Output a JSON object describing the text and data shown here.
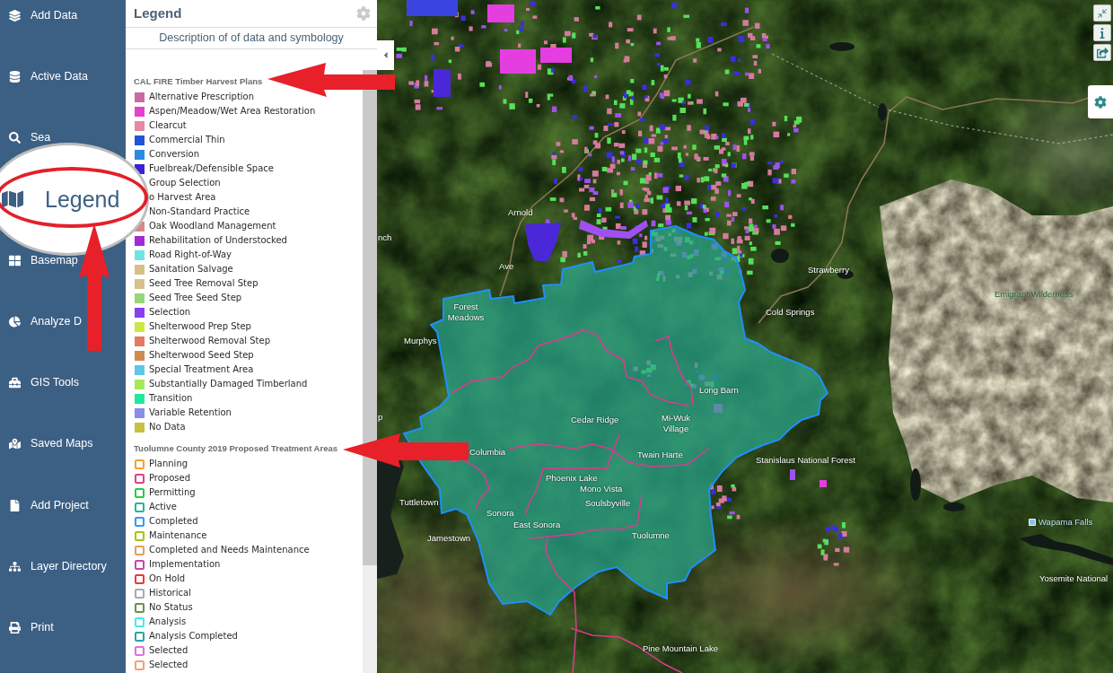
{
  "sidebar": {
    "items": [
      {
        "label": "Add Data",
        "magnified": false
      },
      {
        "label": "Active Data",
        "magnified": false
      },
      {
        "label": "Sea",
        "magnified": false
      },
      {
        "label": "Legend",
        "magnified": true
      },
      {
        "label": "Basemap",
        "magnified": false
      },
      {
        "label": "Analyze D",
        "magnified": false
      },
      {
        "label": "GIS Tools",
        "magnified": false
      },
      {
        "label": "Saved Maps",
        "magnified": false
      },
      {
        "label": "Add Project",
        "magnified": false
      },
      {
        "label": "Layer Directory",
        "magnified": false
      },
      {
        "label": "Print",
        "magnified": false
      }
    ]
  },
  "legend_panel": {
    "title": "Legend",
    "subtitle": "Description of of data and symbology",
    "sections": [
      {
        "title": "CAL FIRE Timber Harvest Plans",
        "kind": "fill",
        "items": [
          {
            "label": "Alternative Prescription",
            "color": "#c86aa0"
          },
          {
            "label": "Aspen/Meadow/Wet Area Restoration",
            "color": "#e83fd0"
          },
          {
            "label": "Clearcut",
            "color": "#e48aa2"
          },
          {
            "label": "Commercial Thin",
            "color": "#1f55d8"
          },
          {
            "label": "Conversion",
            "color": "#2b8be0"
          },
          {
            "label": "Fuelbreak/Defensible Space",
            "color": "#3a22d6"
          },
          {
            "label": "Group Selection"
          },
          {
            "label": "o Harvest Area"
          },
          {
            "label": "Non-Standard Practice"
          },
          {
            "label": "Oak Woodland Management",
            "color": "#d98888"
          },
          {
            "label": "Rehabilitation of Understocked",
            "color": "#a22ad8"
          },
          {
            "label": "Road Right-of-Way",
            "color": "#6de6de"
          },
          {
            "label": "Sanitation Salvage",
            "color": "#d8bf85"
          },
          {
            "label": "Seed Tree Removal Step",
            "color": "#d6c28a"
          },
          {
            "label": "Seed Tree Seed Step",
            "color": "#96d878"
          },
          {
            "label": "Selection",
            "color": "#8a3ef0"
          },
          {
            "label": "Shelterwood Prep Step",
            "color": "#cce840"
          },
          {
            "label": "Shelterwood Removal Step",
            "color": "#e47a60"
          },
          {
            "label": "Shelterwood Seed Step",
            "color": "#d08a50"
          },
          {
            "label": "Special Treatment Area",
            "color": "#5cc8e8"
          },
          {
            "label": "Substantially Damaged Timberland",
            "color": "#a8e858"
          },
          {
            "label": "Transition",
            "color": "#20e8a0"
          },
          {
            "label": "Variable Retention",
            "color": "#8a8cec"
          },
          {
            "label": "No Data",
            "color": "#c8c040"
          }
        ]
      },
      {
        "title": "Tuolumne County 2019 Proposed Treatment Areas",
        "kind": "outline",
        "items": [
          {
            "label": "Planning",
            "color": "#f5a030"
          },
          {
            "label": "Proposed",
            "color": "#e0408a"
          },
          {
            "label": "Permitting",
            "color": "#22cc44"
          },
          {
            "label": "Active",
            "color": "#1fb89a"
          },
          {
            "label": "Completed",
            "color": "#3399ff"
          },
          {
            "label": "Maintenance",
            "color": "#a8c400"
          },
          {
            "label": "Completed and Needs Maintenance",
            "color": "#e0a060"
          },
          {
            "label": "Implementation",
            "color": "#cc44aa"
          },
          {
            "label": "On Hold",
            "color": "#e83a3a"
          },
          {
            "label": "Historical",
            "color": "#aaaaaa"
          },
          {
            "label": "No Status",
            "color": "#6b8e4e"
          },
          {
            "label": "Analysis",
            "color": "#44eeee"
          },
          {
            "label": "Analysis Completed",
            "color": "#22a8a8"
          },
          {
            "label": "Selected",
            "color": "#e070e0"
          },
          {
            "label": "Selected",
            "color": "#f5a070"
          }
        ]
      }
    ]
  },
  "map": {
    "labels": [
      {
        "text": "nch",
        "kind": "place"
      },
      {
        "text": "Arnold",
        "kind": "place"
      },
      {
        "text": "Ave",
        "kind": "place"
      },
      {
        "text": "Forest Meadows",
        "kind": "place"
      },
      {
        "text": "Murphys",
        "kind": "place"
      },
      {
        "text": "p",
        "kind": "place"
      },
      {
        "text": "Strawberry",
        "kind": "place"
      },
      {
        "text": "Cold Springs",
        "kind": "place"
      },
      {
        "text": "Emigrant Wilderness",
        "kind": "area"
      },
      {
        "text": "Cedar Ridge",
        "kind": "place"
      },
      {
        "text": "Long Barn",
        "kind": "place"
      },
      {
        "text": "Mi-Wuk Village",
        "kind": "place"
      },
      {
        "text": "Twain Harte",
        "kind": "place"
      },
      {
        "text": "Columbia",
        "kind": "place"
      },
      {
        "text": "Phoenix Lake",
        "kind": "place"
      },
      {
        "text": "Mono Vista",
        "kind": "place"
      },
      {
        "text": "Soulsbyville",
        "kind": "place"
      },
      {
        "text": "Tuttletown",
        "kind": "place"
      },
      {
        "text": "Sonora",
        "kind": "place"
      },
      {
        "text": "East Sonora",
        "kind": "place"
      },
      {
        "text": "Tuolumne",
        "kind": "place"
      },
      {
        "text": "Jamestown",
        "kind": "place"
      },
      {
        "text": "Stanislaus National Forest",
        "kind": "place"
      },
      {
        "text": "Wapama Falls",
        "kind": "poi"
      },
      {
        "text": "Yosemite National",
        "kind": "place"
      },
      {
        "text": "Pine Mountain Lake",
        "kind": "place"
      }
    ]
  }
}
